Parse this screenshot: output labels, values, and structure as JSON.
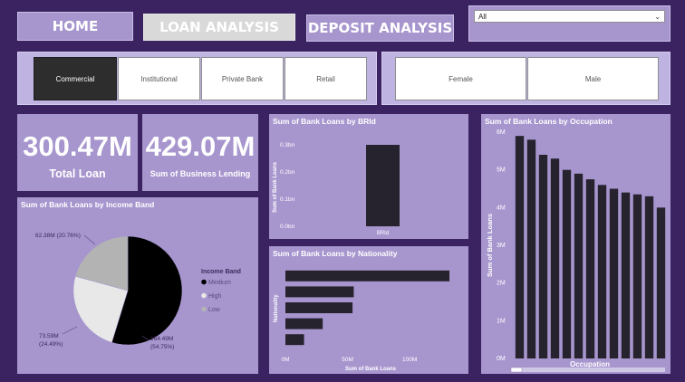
{
  "nav": {
    "home": "HOME",
    "loan_analysis": "LOAN ANALYSIS",
    "deposit_analysis": "DEPOSIT ANALYSIS"
  },
  "dropdown": {
    "value": "All"
  },
  "segments": [
    "Commercial",
    "Institutional",
    "Private Bank",
    "Retail"
  ],
  "selected_segment": "Commercial",
  "genders": [
    "Female",
    "Male"
  ],
  "kpis": {
    "total_loan": {
      "value": "300.47M",
      "label": "Total Loan"
    },
    "business_lending": {
      "value": "429.07M",
      "label": "Sum of Business Lending"
    }
  },
  "colors": {
    "background": "#3a2360",
    "panel": "#a795ce",
    "bar": "#26232e",
    "selected": "#2d2d2d"
  },
  "chart_data": [
    {
      "type": "pie",
      "title": "Sum of Bank Loans by Income Band",
      "legend_title": "Income Band",
      "legend_position": "right",
      "categories": [
        "Medium",
        "High",
        "Low"
      ],
      "values": [
        164.49,
        73.59,
        62.38
      ],
      "labels": [
        "164.49M\n(54.75%)",
        "73.59M\n(24.49%)",
        "62.38M (20.76%)"
      ],
      "colors": [
        "#000000",
        "#e8e8e8",
        "#b3b3b3"
      ]
    },
    {
      "type": "bar",
      "title": "Sum of Bank Loans by BRId",
      "categories": [
        "BRId"
      ],
      "values": [
        0.3
      ],
      "ylabel": "Sum of Bank Loans",
      "yticks": [
        "0.0bn",
        "0.1bn",
        "0.2bn",
        "0.3bn"
      ],
      "ylim": [
        0,
        0.3
      ]
    },
    {
      "type": "bar",
      "orientation": "horizontal",
      "title": "Sum of Bank Loans by Nationality",
      "categories": [
        "",
        "",
        "",
        "",
        ""
      ],
      "values": [
        132,
        55,
        54,
        30,
        15
      ],
      "xlabel": "Sum of Bank Loans",
      "ylabel": "Nationality",
      "xticks": [
        "0M",
        "50M",
        "100M"
      ],
      "xlim": [
        0,
        140
      ]
    },
    {
      "type": "bar",
      "title": "Sum of Bank Loans by Occupation",
      "values": [
        5.9,
        5.8,
        5.4,
        5.3,
        5.0,
        4.9,
        4.75,
        4.6,
        4.5,
        4.4,
        4.35,
        4.3,
        4.0
      ],
      "xlabel": "Occupation",
      "ylabel": "Sum of Bank Loans",
      "yticks": [
        "0M",
        "1M",
        "2M",
        "3M",
        "4M",
        "5M",
        "6M"
      ],
      "ylim": [
        0,
        6
      ]
    }
  ]
}
